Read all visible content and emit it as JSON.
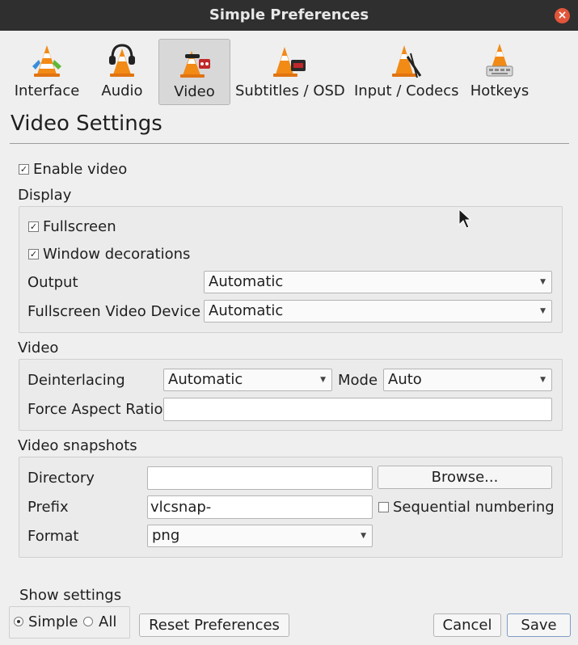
{
  "window": {
    "title": "Simple Preferences"
  },
  "categories": [
    {
      "label": "Interface",
      "icon": "interface-cone-icon"
    },
    {
      "label": "Audio",
      "icon": "audio-cone-icon"
    },
    {
      "label": "Video",
      "icon": "video-cone-icon",
      "selected": true
    },
    {
      "label": "Subtitles / OSD",
      "icon": "subtitles-cone-icon"
    },
    {
      "label": "Input / Codecs",
      "icon": "codecs-cone-icon"
    },
    {
      "label": "Hotkeys",
      "icon": "hotkeys-cone-icon"
    }
  ],
  "page": {
    "heading": "Video Settings"
  },
  "enable_video": {
    "label": "Enable video",
    "checked": true
  },
  "display": {
    "title": "Display",
    "fullscreen": {
      "label": "Fullscreen",
      "checked": true
    },
    "window_decorations": {
      "label": "Window decorations",
      "checked": true
    },
    "output": {
      "label": "Output",
      "value": "Automatic"
    },
    "fullscreen_device": {
      "label": "Fullscreen Video Device",
      "value": "Automatic"
    }
  },
  "video": {
    "title": "Video",
    "deinterlacing": {
      "label": "Deinterlacing",
      "value": "Automatic"
    },
    "mode": {
      "label": "Mode",
      "value": "Auto"
    },
    "force_aspect": {
      "label": "Force Aspect Ratio",
      "value": ""
    }
  },
  "snapshots": {
    "title": "Video snapshots",
    "directory": {
      "label": "Directory",
      "value": ""
    },
    "browse_label": "Browse...",
    "prefix": {
      "label": "Prefix",
      "value": "vlcsnap-"
    },
    "sequential": {
      "label": "Sequential numbering",
      "checked": false
    },
    "format": {
      "label": "Format",
      "value": "png"
    }
  },
  "show_settings": {
    "title": "Show settings",
    "simple": "Simple",
    "all": "All",
    "selected": "Simple"
  },
  "buttons": {
    "reset": "Reset Preferences",
    "cancel": "Cancel",
    "save": "Save"
  },
  "colors": {
    "titlebar": "#2f2f2f",
    "close": "#e2553a",
    "vlc_orange": "#f28a16"
  }
}
